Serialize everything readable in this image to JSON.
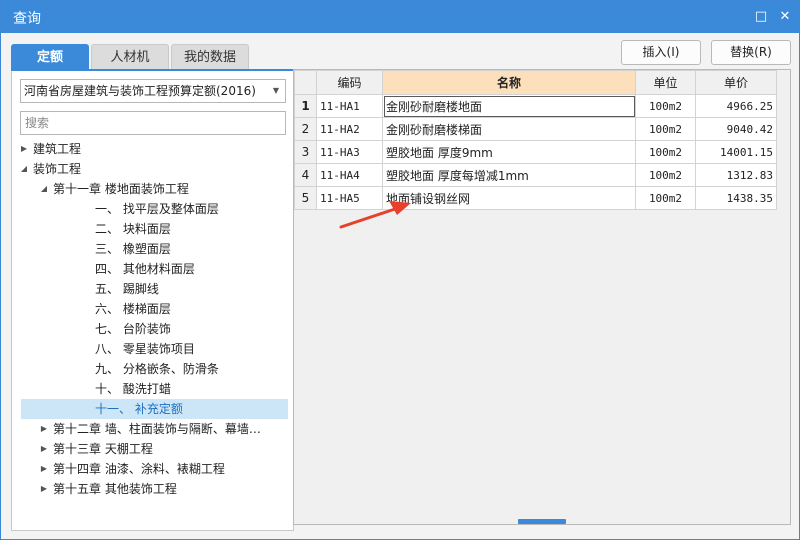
{
  "window": {
    "title": "查询",
    "maximize_glyph": "□",
    "close_glyph": "✕"
  },
  "tabs": [
    {
      "label": "定额",
      "active": true
    },
    {
      "label": "人材机",
      "active": false
    },
    {
      "label": "我的数据",
      "active": false
    }
  ],
  "buttons": {
    "insert": "插入(I)",
    "replace": "替换(R)"
  },
  "left": {
    "selected_library": "河南省房屋建筑与装饰工程预算定额(2016)",
    "search_placeholder": "搜索",
    "tree": [
      {
        "label": "建筑工程",
        "state": "collapsed"
      },
      {
        "label": "装饰工程",
        "state": "expanded"
      },
      {
        "label": "第十一章 楼地面装饰工程",
        "state": "expanded"
      },
      {
        "label": "一、 找平层及整体面层",
        "state": "leaf"
      },
      {
        "label": "二、 块料面层",
        "state": "leaf"
      },
      {
        "label": "三、 橡塑面层",
        "state": "leaf"
      },
      {
        "label": "四、 其他材料面层",
        "state": "leaf"
      },
      {
        "label": "五、 踢脚线",
        "state": "leaf"
      },
      {
        "label": "六、 楼梯面层",
        "state": "leaf"
      },
      {
        "label": "七、 台阶装饰",
        "state": "leaf"
      },
      {
        "label": "八、 零星装饰项目",
        "state": "leaf"
      },
      {
        "label": "九、 分格嵌条、防滑条",
        "state": "leaf"
      },
      {
        "label": "十、 酸洗打蜡",
        "state": "leaf"
      },
      {
        "label": "十一、 补充定额",
        "state": "leaf",
        "selected": true
      },
      {
        "label": "第十二章 墙、柱面装饰与隔断、幕墙…",
        "state": "collapsed"
      },
      {
        "label": "第十三章 天棚工程",
        "state": "collapsed"
      },
      {
        "label": "第十四章 油漆、涂料、裱糊工程",
        "state": "collapsed"
      },
      {
        "label": "第十五章 其他装饰工程",
        "state": "collapsed"
      }
    ]
  },
  "grid": {
    "columns": [
      "编码",
      "名称",
      "单位",
      "单价"
    ],
    "rows": [
      {
        "n": "1",
        "code": "11-HA1",
        "name": "金刚砂耐磨楼地面",
        "unit": "100m2",
        "price": "4966.25"
      },
      {
        "n": "2",
        "code": "11-HA2",
        "name": "金刚砂耐磨楼梯面",
        "unit": "100m2",
        "price": "9040.42"
      },
      {
        "n": "3",
        "code": "11-HA3",
        "name": "塑胶地面 厚度9mm",
        "unit": "100m2",
        "price": "14001.15"
      },
      {
        "n": "4",
        "code": "11-HA4",
        "name": "塑胶地面 厚度每增减1mm",
        "unit": "100m2",
        "price": "1312.83"
      },
      {
        "n": "5",
        "code": "11-HA5",
        "name": "地面铺设钢丝网",
        "unit": "100m2",
        "price": "1438.35"
      }
    ],
    "current_row": 0
  },
  "colors": {
    "accent": "#3b8ad9",
    "header_highlight": "#fce0bb",
    "selected_tree": "#cde6f7",
    "annotation_arrow": "#e8402a"
  }
}
